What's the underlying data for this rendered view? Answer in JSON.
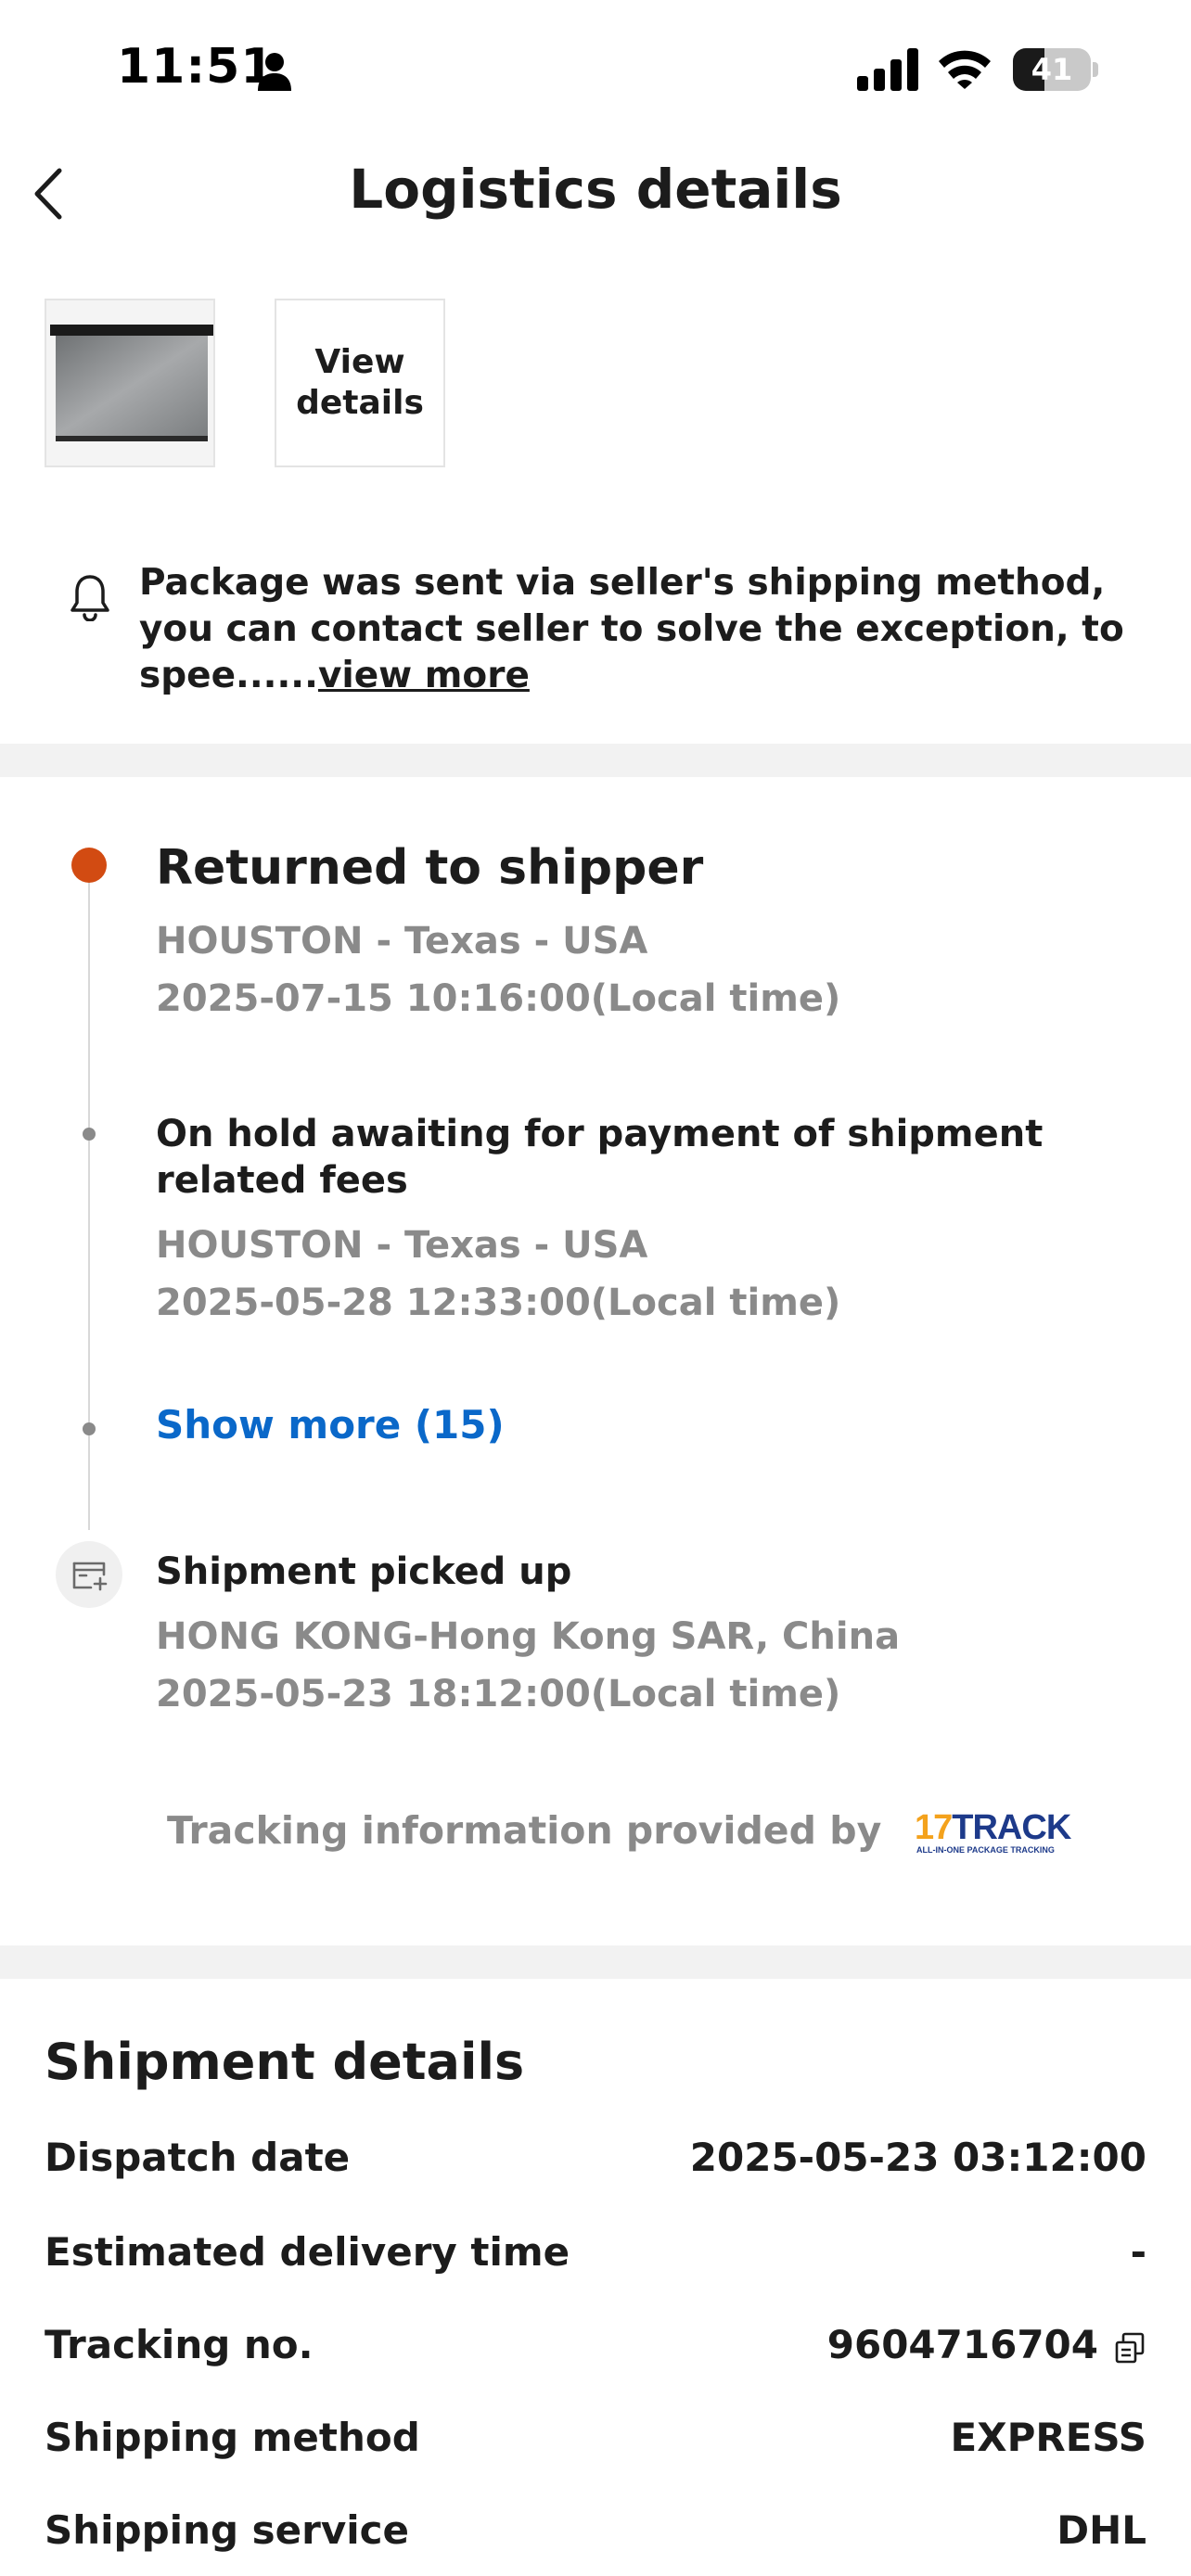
{
  "status_bar": {
    "time": "11:51",
    "battery_level": "41",
    "battery_fraction": 0.41
  },
  "header": {
    "title": "Logistics details",
    "back_icon": "chevron-left-icon"
  },
  "product": {
    "view_details_label": "View details"
  },
  "notice": {
    "icon": "bell-icon",
    "text": "Package was sent via seller's shipping method, you can contact seller to solve the exception, to spee......",
    "link_text": "view more"
  },
  "timeline": {
    "events": [
      {
        "title": "Returned to shipper",
        "location": "HOUSTON - Texas - USA",
        "time": "2025-07-15 10:16:00(Local time)"
      },
      {
        "title": "On hold awaiting for payment of shipment related fees",
        "location": "HOUSTON - Texas - USA",
        "time": "2025-05-28 12:33:00(Local time)"
      },
      {
        "title": "Shipment picked up",
        "location": "HONG KONG-Hong Kong SAR, China",
        "time": "2025-05-23 18:12:00(Local time)"
      }
    ],
    "show_more_label": "Show more (15)",
    "active_color": "#d24b12",
    "link_color": "#0a68c9"
  },
  "tracking_provider": {
    "label": "Tracking information provided by",
    "logo_number": "17",
    "logo_word": "TRACK",
    "logo_tagline": "ALL-IN-ONE PACKAGE TRACKING"
  },
  "shipment_details": {
    "title": "Shipment details",
    "rows": [
      {
        "label": "Dispatch date",
        "value": "2025-05-23 03:12:00"
      },
      {
        "label": "Estimated delivery time",
        "value": "-"
      },
      {
        "label": "Tracking no.",
        "value": "9604716704"
      },
      {
        "label": "Shipping method",
        "value": "EXPRESS"
      },
      {
        "label": "Shipping service",
        "value": "DHL"
      }
    ]
  }
}
